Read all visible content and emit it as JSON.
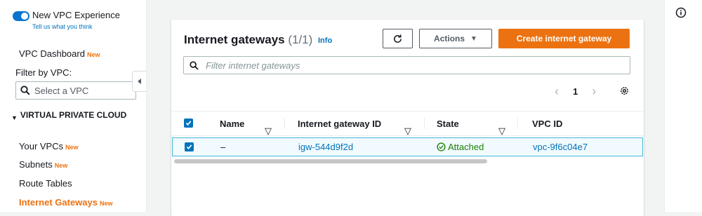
{
  "sidebar": {
    "toggle_title": "New VPC Experience",
    "toggle_link": "Tell us what you think",
    "vpc_dashboard": "VPC Dashboard",
    "new_badge": "New",
    "filter_label": "Filter by VPC:",
    "select_placeholder": "Select a VPC",
    "section_title": "VIRTUAL PRIVATE CLOUD",
    "items": [
      {
        "label": "Your VPCs",
        "badge": "New"
      },
      {
        "label": "Subnets",
        "badge": "New"
      },
      {
        "label": "Route Tables",
        "badge": ""
      },
      {
        "label": "Internet Gateways",
        "badge": "New"
      }
    ]
  },
  "panel": {
    "title": "Internet gateways",
    "count": "(1/1)",
    "info": "Info",
    "actions_label": "Actions",
    "create_label": "Create internet gateway",
    "search_placeholder": "Filter internet gateways",
    "page_number": "1",
    "columns": [
      "Name",
      "Internet gateway ID",
      "State",
      "VPC ID"
    ],
    "rows": [
      {
        "name": "–",
        "gateway_id": "igw-544d9f2d",
        "state": "Attached",
        "vpc_id": "vpc-9f6c04e7",
        "selected": true
      }
    ]
  },
  "colors": {
    "accent": "#ec7211",
    "link": "#0073bb",
    "success": "#1d8102"
  },
  "icons": [
    "search-icon",
    "refresh-icon",
    "caret-down-icon",
    "chevron-left-icon",
    "chevron-right-icon",
    "settings-icon",
    "check-circle-icon",
    "info-icon"
  ]
}
